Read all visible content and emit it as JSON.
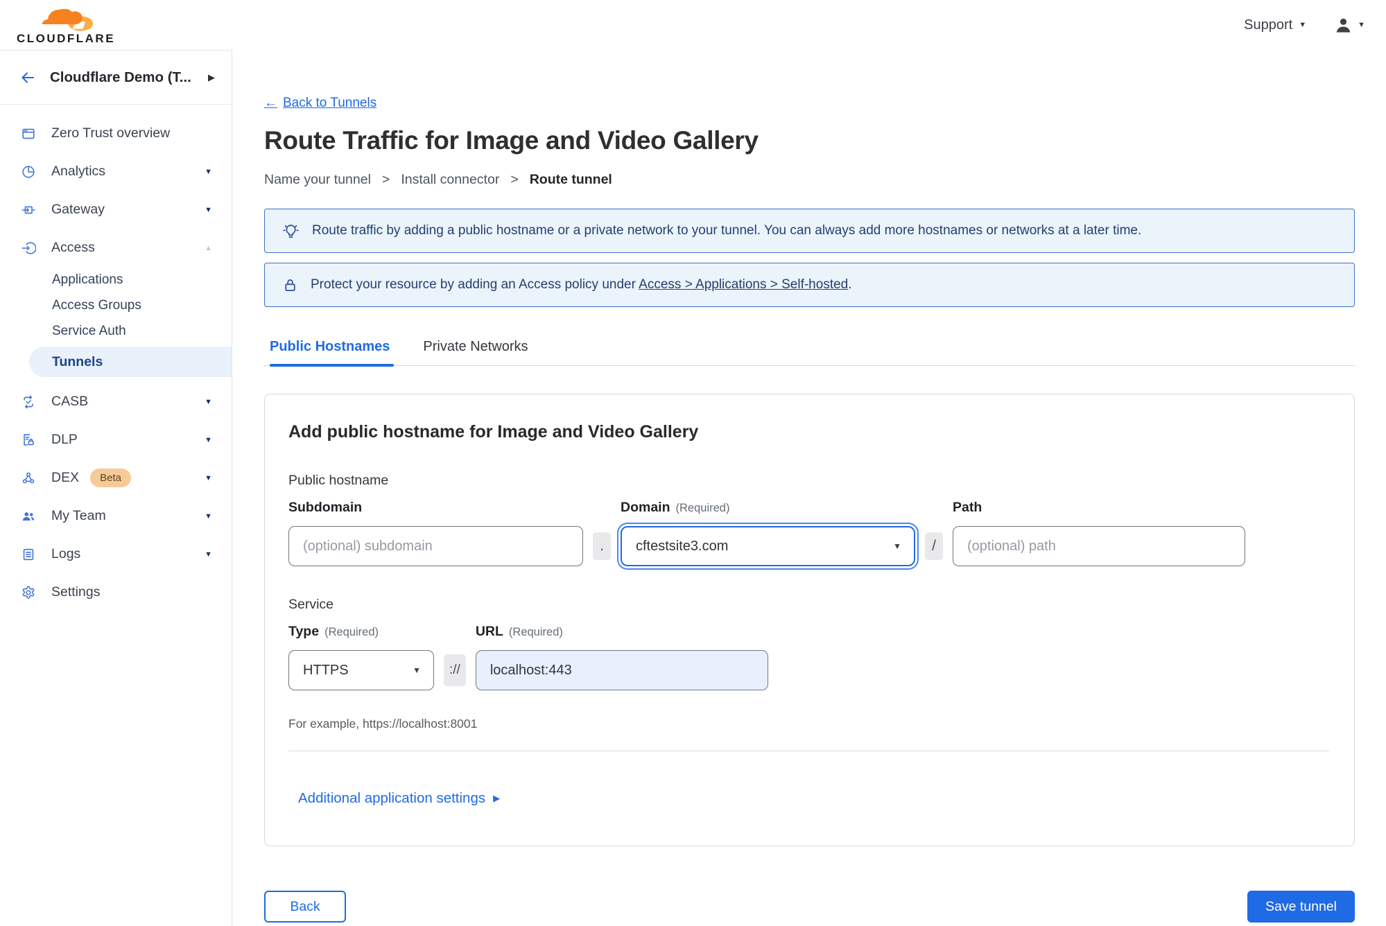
{
  "colors": {
    "primary_blue": "#1F6AE5",
    "sidebar_icon_blue": "#4272D9",
    "active_item_navy": "#1B4489",
    "active_item_bg": "#E9F1FB",
    "banner_bg": "#EBF3FB",
    "banner_border": "#3B6FC6",
    "banner_text": "#24406F",
    "beta_badge_bg": "#F6CB97",
    "logo_orange": "#F6821F",
    "logo_light_orange": "#FBAD41",
    "url_field_bg": "#E7F0FC"
  },
  "icons": {
    "caret_down": "▼",
    "caret_up": "▲",
    "chevron_right": "▶",
    "arrow_left": "←"
  },
  "topbar": {
    "brand": "CLOUDFLARE",
    "support": "Support"
  },
  "sidebar": {
    "account": "Cloudflare Demo (T...",
    "items": {
      "overview": "Zero Trust overview",
      "analytics": "Analytics",
      "gateway": "Gateway",
      "access": "Access",
      "applications": "Applications",
      "access_groups": "Access Groups",
      "service_auth": "Service Auth",
      "tunnels": "Tunnels",
      "casb": "CASB",
      "dlp": "DLP",
      "dex": "DEX",
      "dex_badge": "Beta",
      "my_team": "My Team",
      "logs": "Logs",
      "settings": "Settings"
    }
  },
  "page": {
    "back_link": "Back to Tunnels",
    "title": "Route Traffic for Image and Video Gallery",
    "breadcrumb": {
      "steps": [
        "Name your tunnel",
        "Install connector",
        "Route tunnel"
      ],
      "separator": ">"
    },
    "banners": {
      "tip": "Route traffic by adding a public hostname or a private network to your tunnel. You can always add more hostnames or networks at a later time.",
      "protect_prefix": "Protect your resource by adding an Access policy under",
      "protect_link": "Access > Applications > Self-hosted",
      "protect_suffix": "."
    },
    "tabs": [
      "Public Hostnames",
      "Private Networks"
    ]
  },
  "form": {
    "heading": "Add public hostname for Image and Video Gallery",
    "hostname_section": "Public hostname",
    "subdomain": {
      "label": "Subdomain",
      "placeholder": "(optional) subdomain"
    },
    "domain": {
      "label": "Domain",
      "required": "(Required)",
      "value": "cftestsite3.com"
    },
    "path": {
      "label": "Path",
      "placeholder": "(optional) path"
    },
    "sep_dot": ".",
    "sep_slash": "/",
    "sep_scheme": "://",
    "service_section": "Service",
    "type": {
      "label": "Type",
      "required": "(Required)",
      "value": "HTTPS"
    },
    "url": {
      "label": "URL",
      "required": "(Required)",
      "value": "localhost:443"
    },
    "example": "For example, https://localhost:8001",
    "additional_settings": "Additional application settings",
    "back_button": "Back",
    "save_button": "Save tunnel"
  }
}
